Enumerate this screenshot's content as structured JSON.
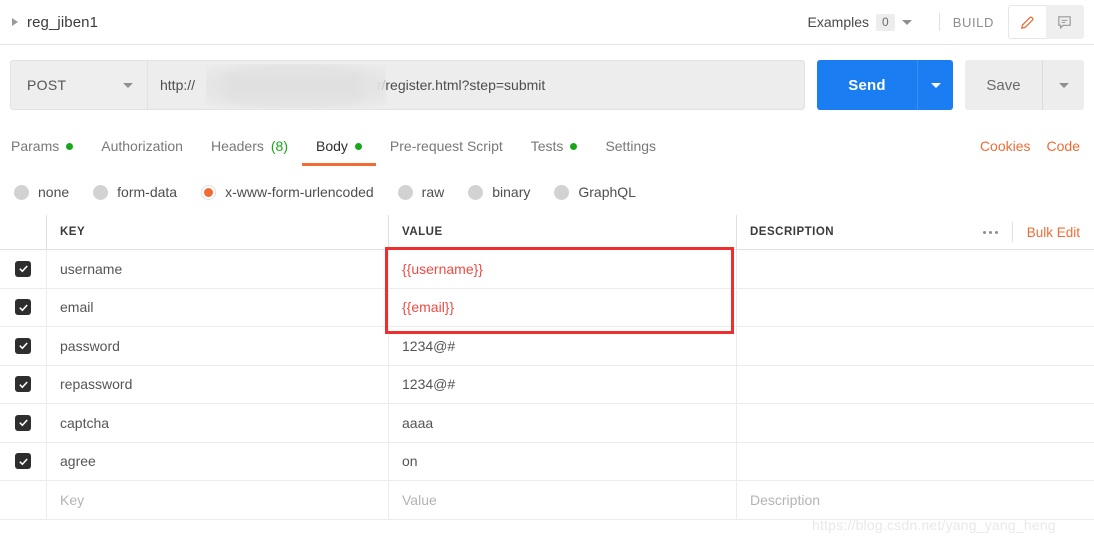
{
  "header": {
    "request_title": "reg_jiben1",
    "expand_icon": "caret-right-icon",
    "examples_label": "Examples",
    "examples_count": "0",
    "build_label": "BUILD",
    "edit_icon": "pencil-icon",
    "comment_icon": "comment-icon"
  },
  "urlbar": {
    "method": "POST",
    "url_prefix": "http://",
    "url_suffix": "er/register.html?step=submit",
    "url_redacted": true,
    "send_label": "Send",
    "save_label": "Save"
  },
  "tabs": [
    {
      "label": "Params",
      "indicator": "dot",
      "active": false
    },
    {
      "label": "Authorization",
      "indicator": "none",
      "active": false
    },
    {
      "label": "Headers",
      "indicator": "count",
      "count": "(8)",
      "active": false
    },
    {
      "label": "Body",
      "indicator": "dot",
      "active": true
    },
    {
      "label": "Pre-request Script",
      "indicator": "none",
      "active": false
    },
    {
      "label": "Tests",
      "indicator": "dot",
      "active": false
    },
    {
      "label": "Settings",
      "indicator": "none",
      "active": false
    }
  ],
  "tabs_right": [
    {
      "label": "Cookies"
    },
    {
      "label": "Code"
    }
  ],
  "body_types": [
    {
      "label": "none",
      "selected": false
    },
    {
      "label": "form-data",
      "selected": false
    },
    {
      "label": "x-www-form-urlencoded",
      "selected": true
    },
    {
      "label": "raw",
      "selected": false
    },
    {
      "label": "binary",
      "selected": false
    },
    {
      "label": "GraphQL",
      "selected": false
    }
  ],
  "table": {
    "columns": [
      "KEY",
      "VALUE",
      "DESCRIPTION"
    ],
    "bulk_edit_label": "Bulk Edit",
    "more_icon": "ellipsis-icon",
    "rows": [
      {
        "checked": true,
        "key": "username",
        "value": "{{username}}",
        "value_is_variable": true,
        "description": ""
      },
      {
        "checked": true,
        "key": "email",
        "value": "{{email}}",
        "value_is_variable": true,
        "description": ""
      },
      {
        "checked": true,
        "key": "password",
        "value": "1234@#",
        "value_is_variable": false,
        "description": ""
      },
      {
        "checked": true,
        "key": "repassword",
        "value": "1234@#",
        "value_is_variable": false,
        "description": ""
      },
      {
        "checked": true,
        "key": "captcha",
        "value": "aaaa",
        "value_is_variable": false,
        "description": ""
      },
      {
        "checked": true,
        "key": "agree",
        "value": "on",
        "value_is_variable": false,
        "description": ""
      }
    ],
    "empty_row": {
      "key_placeholder": "Key",
      "value_placeholder": "Value",
      "description_placeholder": "Description"
    }
  },
  "annotation": {
    "type": "red-rectangle-highlight",
    "covers": "value cells of username and email rows"
  },
  "watermark": "https://blog.csdn.net/yang_yang_heng",
  "colors": {
    "accent_orange": "#ef6c36",
    "send_blue": "#1a7ef2",
    "indicator_green": "#17a81a",
    "variable_red": "#ef4b44",
    "annotation_red": "#ed2f2f"
  }
}
